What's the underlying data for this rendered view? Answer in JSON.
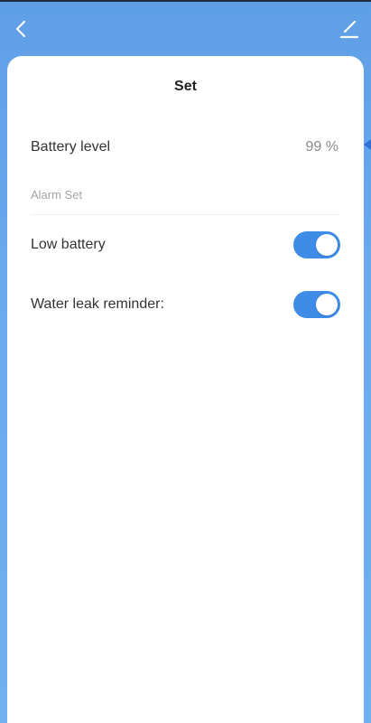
{
  "header": {
    "back_icon": "chevron-left-icon",
    "edit_icon": "pencil-icon"
  },
  "card": {
    "title": "Set"
  },
  "battery": {
    "label": "Battery level",
    "value": "99 %"
  },
  "alarm": {
    "section_label": "Alarm Set",
    "items": [
      {
        "label": "Low battery",
        "enabled": true
      },
      {
        "label": "Water leak reminder:",
        "enabled": true
      }
    ]
  },
  "colors": {
    "background": "#6aa9ee",
    "toggle_on": "#3e8ce8",
    "card": "#ffffff"
  }
}
